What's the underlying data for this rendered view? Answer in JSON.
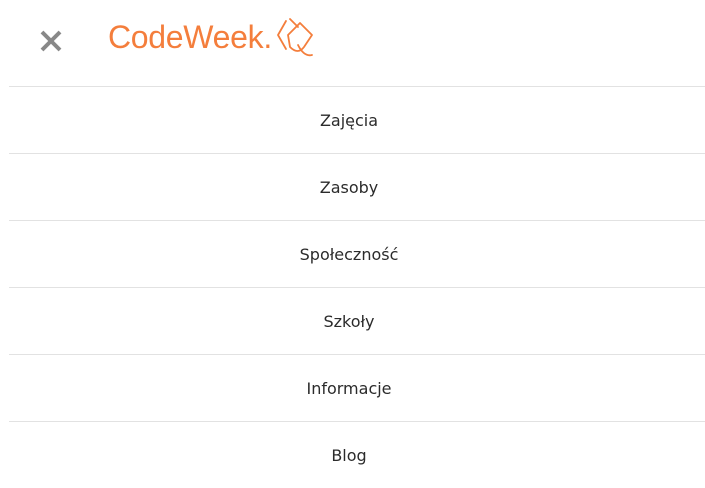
{
  "header": {
    "close_icon": "close-icon",
    "logo_text": "CodeWeek.",
    "logo_mark_icon": "mouse-pointer-logo-icon",
    "brand_color": "#f47e3c",
    "icon_color": "#888888"
  },
  "menu": {
    "items": [
      {
        "label": "Zajęcia"
      },
      {
        "label": "Zasoby"
      },
      {
        "label": "Społeczność"
      },
      {
        "label": "Szkoły"
      },
      {
        "label": "Informacje"
      },
      {
        "label": "Blog"
      }
    ]
  }
}
